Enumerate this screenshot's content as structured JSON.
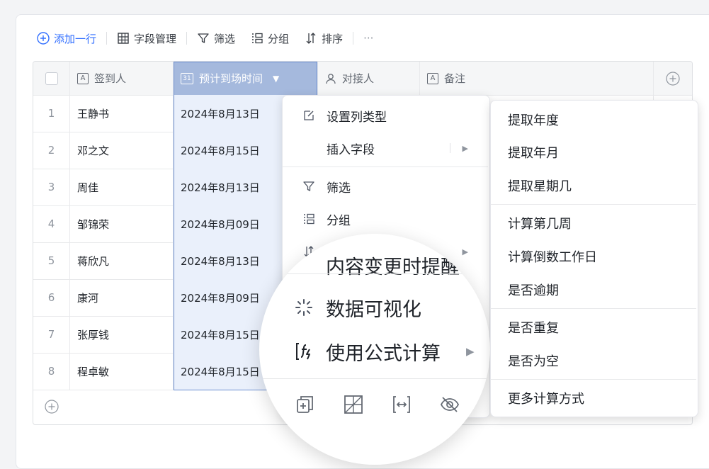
{
  "toolbar": {
    "add_row": "添加一行",
    "field_manage": "字段管理",
    "filter": "筛选",
    "group": "分组",
    "sort": "排序",
    "more": "···"
  },
  "table": {
    "headers": [
      "签到人",
      "预计到场时间",
      "对接人",
      "备注"
    ],
    "header_type_labels": [
      "A",
      "31",
      "",
      "A"
    ],
    "rows": [
      {
        "num": "1",
        "name": "王静书",
        "date": "2024年8月13日"
      },
      {
        "num": "2",
        "name": "邓之文",
        "date": "2024年8月15日"
      },
      {
        "num": "3",
        "name": "周佳",
        "date": "2024年8月13日"
      },
      {
        "num": "4",
        "name": "邹锦荣",
        "date": "2024年8月09日"
      },
      {
        "num": "5",
        "name": "蒋欣凡",
        "date": "2024年8月13日"
      },
      {
        "num": "6",
        "name": "康河",
        "date": "2024年8月09日"
      },
      {
        "num": "7",
        "name": "张厚钱",
        "date": "2024年8月15日"
      },
      {
        "num": "8",
        "name": "程卓敏",
        "date": "2024年8月15日"
      }
    ]
  },
  "column_menu": {
    "set_type": "设置列类型",
    "insert_field": "插入字段",
    "filter": "筛选",
    "group": "分组",
    "notify": "内容变更时提醒",
    "visualize": "数据可视化",
    "formula": "使用公式计算"
  },
  "formula_submenu": {
    "items": [
      "提取年度",
      "提取年月",
      "提取星期几",
      "计算第几周",
      "计算倒数工作日",
      "是否逾期",
      "是否重复",
      "是否为空",
      "更多计算方式"
    ]
  },
  "colors": {
    "accent": "#3370ff",
    "selected_header": "#a5b9dd",
    "selected_cell": "#eaf0fb"
  }
}
